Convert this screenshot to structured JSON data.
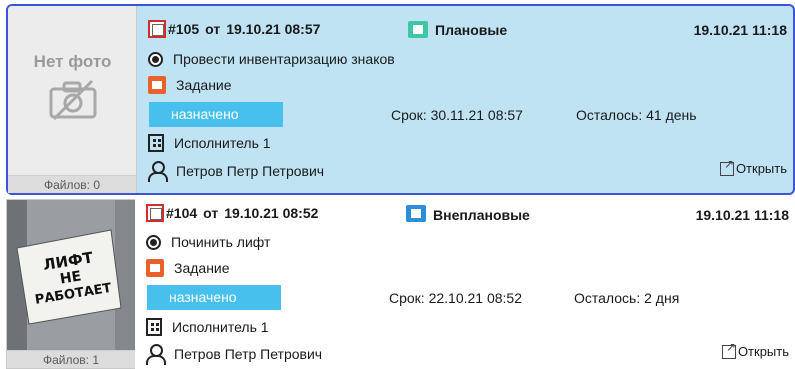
{
  "cards": [
    {
      "number": "#105",
      "from_label": "от",
      "created": "19.10.21 08:57",
      "type_label": "Плановые",
      "type_color": "#3fc7a4",
      "updated": "19.10.21 11:18",
      "title": "Провести инвентаризацию знаков",
      "kind": "Задание",
      "status": "назначено",
      "deadline": "Срок: 30.11.21 08:57",
      "remaining": "Осталось: 41 день",
      "executor": "Исполнитель 1",
      "person": "Петров Петр Петрович",
      "open_label": "Открыть",
      "photo_label": "Нет фото",
      "files": "Файлов: 0"
    },
    {
      "number": "#104",
      "from_label": "от",
      "created": "19.10.21 08:52",
      "type_label": "Внеплановые",
      "type_color": "#2a8fd6",
      "updated": "19.10.21 11:18",
      "title": "Починить лифт",
      "kind": "Задание",
      "status": "назначено",
      "deadline": "Срок: 22.10.21 08:52",
      "remaining": "Осталось: 2 дня",
      "executor": "Исполнитель 1",
      "person": "Петров Петр Петрович",
      "open_label": "Открыть",
      "photo_sign": [
        "ЛИФТ",
        "НЕ",
        "РАБОТАЕТ"
      ],
      "files": "Файлов: 1"
    }
  ]
}
